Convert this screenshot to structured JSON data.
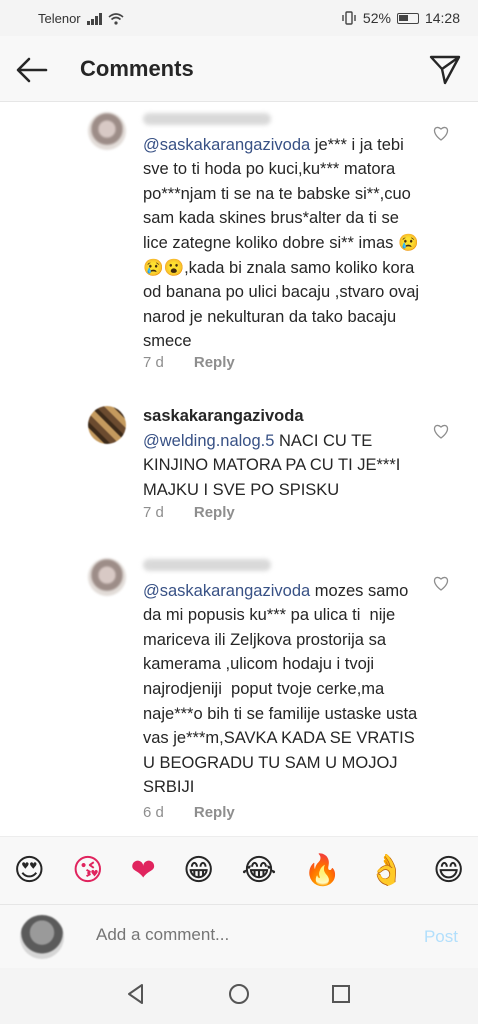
{
  "status": {
    "carrier": "Telenor",
    "battery": "52%",
    "time": "14:28"
  },
  "header": {
    "title": "Comments",
    "back_icon": "arrow-left-icon",
    "send_icon": "paper-plane-icon"
  },
  "comments": [
    {
      "username": "",
      "mention": "@saskakarangazivoda",
      "text": " je*** i ja tebi sve to ti hoda po kuci,ku*** matora po***njam ti se na te babske si**,cuo sam kada skines brus*alter da ti se lice zategne koliko dobre si** imas 😢😢😮,kada bi znala samo koliko kora od banana po ulici bacaju ,stvaro ovaj narod je nekulturan da tako bacaju smece",
      "time": "7 d",
      "reply": "Reply"
    },
    {
      "username": "saskakarangazivoda",
      "mention": "@welding.nalog.5",
      "text": " NACI CU TE KINJINO MATORA PA CU TI JE***I MAJKU I SVE PO SPISKU",
      "time": "7 d",
      "reply": "Reply"
    },
    {
      "username": "",
      "mention": "@saskakarangazivoda",
      "text": " mozes samo da mi popusis ku*** pa ulica ti  nije mariceva ili Zeljkova prostorija sa kamerama ,ulicom hodaju i tvoji najrodjeniji  poput tvoje cerke,ma naje***o bih ti se familije ustaske usta vas je***m,SAVKA KADA SE VRATIS U BEOGRADU TU SAM U MOJOJ SRBIJI",
      "time": "6 d",
      "reply": "Reply"
    }
  ],
  "emoji_bar": [
    "😍",
    "😘",
    "❤",
    "😁",
    "😂",
    "🔥",
    "👌",
    "😄"
  ],
  "composer": {
    "placeholder": "Add a comment...",
    "post": "Post"
  },
  "colors": {
    "mention": "#385185",
    "post_disabled": "#b2dffc",
    "meta": "#8e8e8e"
  }
}
